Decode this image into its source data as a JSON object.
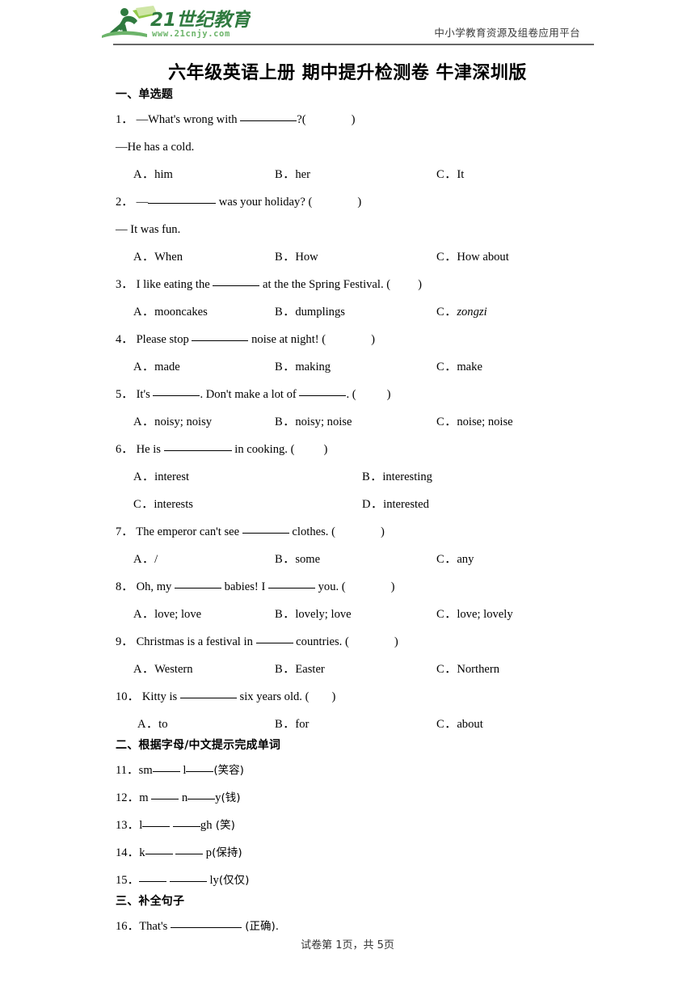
{
  "header": {
    "logo_text": "21世纪教育",
    "logo_url": "www.21cnjy.com",
    "tagline": "中小学教育资源及组卷应用平台",
    "logo_color_dark": "#2f7a3f",
    "logo_color_light": "#6cb46a"
  },
  "title": "六年级英语上册  期中提升检测卷  牛津深圳版",
  "sections": [
    {
      "heading": "一、单选题"
    },
    {
      "heading": "二、根据字母/中文提示完成单词"
    },
    {
      "heading": "三、补全句子"
    }
  ],
  "questions": [
    {
      "num": "1．",
      "stem_pre": "—What's wrong with ",
      "stem_post": "?(",
      "close": ")",
      "second_line": "—He has a cold.",
      "options": [
        {
          "label": "A．",
          "text": "him"
        },
        {
          "label": "B．",
          "text": "her"
        },
        {
          "label": "C．",
          "text": "It"
        }
      ]
    },
    {
      "num": "2．",
      "stem_pre": "—",
      "stem_post": " was your holiday? (",
      "close": ")",
      "second_line": "— It was fun.",
      "options": [
        {
          "label": "A．",
          "text": "When"
        },
        {
          "label": "B．",
          "text": "How"
        },
        {
          "label": "C．",
          "text": "How about"
        }
      ]
    },
    {
      "num": "3．",
      "stem_pre": "I like eating the ",
      "stem_post": " at the the Spring Festival. (",
      "close": ")",
      "options": [
        {
          "label": "A．",
          "text": "mooncakes"
        },
        {
          "label": "B．",
          "text": "dumplings"
        },
        {
          "label": "C．",
          "text": "zongzi",
          "italic": true
        }
      ]
    },
    {
      "num": "4．",
      "stem_pre": "Please stop ",
      "stem_post": " noise at night! (",
      "close": ")",
      "options": [
        {
          "label": "A．",
          "text": "made"
        },
        {
          "label": "B．",
          "text": "making"
        },
        {
          "label": "C．",
          "text": "make"
        }
      ]
    },
    {
      "num": "5．",
      "stem_pre": "It's ",
      "stem_mid": ". Don't make a lot of ",
      "stem_post": ". (",
      "close": ")",
      "options": [
        {
          "label": "A．",
          "text": "noisy; noisy"
        },
        {
          "label": "B．",
          "text": "noisy; noise"
        },
        {
          "label": "C．",
          "text": "noise; noise"
        }
      ]
    },
    {
      "num": "6．",
      "stem_pre": "He is ",
      "stem_post": " in cooking. (",
      "close": ")",
      "options": [
        {
          "label": "A．",
          "text": "interest"
        },
        {
          "label": "B．",
          "text": "interesting"
        },
        {
          "label": "C．",
          "text": "interests"
        },
        {
          "label": "D．",
          "text": "interested"
        }
      ]
    },
    {
      "num": "7．",
      "stem_pre": "The emperor can't see ",
      "stem_post": " clothes. (",
      "close": ")",
      "options": [
        {
          "label": "A．",
          "text": "/"
        },
        {
          "label": "B．",
          "text": "some"
        },
        {
          "label": "C．",
          "text": "any"
        }
      ]
    },
    {
      "num": "8．",
      "stem_pre": "Oh, my ",
      "stem_mid": " babies! I ",
      "stem_post": " you. (",
      "close": ")",
      "options": [
        {
          "label": "A．",
          "text": "love; love"
        },
        {
          "label": "B．",
          "text": "lovely; love"
        },
        {
          "label": "C．",
          "text": "love; lovely"
        }
      ]
    },
    {
      "num": "9．",
      "stem_pre": "Christmas is a festival in ",
      "stem_post": " countries. (",
      "close": ")",
      "options": [
        {
          "label": "A．",
          "text": "Western"
        },
        {
          "label": "B．",
          "text": "Easter"
        },
        {
          "label": "C．",
          "text": "Northern"
        }
      ]
    },
    {
      "num": "10．",
      "stem_pre": "Kitty is ",
      "stem_post": " six years old. (",
      "close": ")",
      "options": [
        {
          "label": "A．",
          "text": "to"
        },
        {
          "label": "B．",
          "text": "for"
        },
        {
          "label": "C．",
          "text": "about"
        }
      ]
    }
  ],
  "word_items": [
    {
      "num": "11．",
      "pre": "sm",
      "mid": " l",
      "hint": "(笑容)"
    },
    {
      "num": "12．",
      "pre": "m ",
      "mid": " n",
      "tail": "y",
      "hint": "(钱)"
    },
    {
      "num": "13．",
      "pre": "l",
      "mid": " ",
      "tail": "gh",
      "hint": " (笑)"
    },
    {
      "num": "14．",
      "pre": "k",
      "mid": " ",
      "tail": " p",
      "hint": "(保持)"
    },
    {
      "num": "15．",
      "pre": "",
      "mid": " ",
      "tail": " ly",
      "hint": "(仅仅)"
    }
  ],
  "sentence_items": [
    {
      "num": "16．",
      "pre": "That's ",
      "post": " (正确)."
    }
  ],
  "footer": "试卷第 1页，共 5页"
}
